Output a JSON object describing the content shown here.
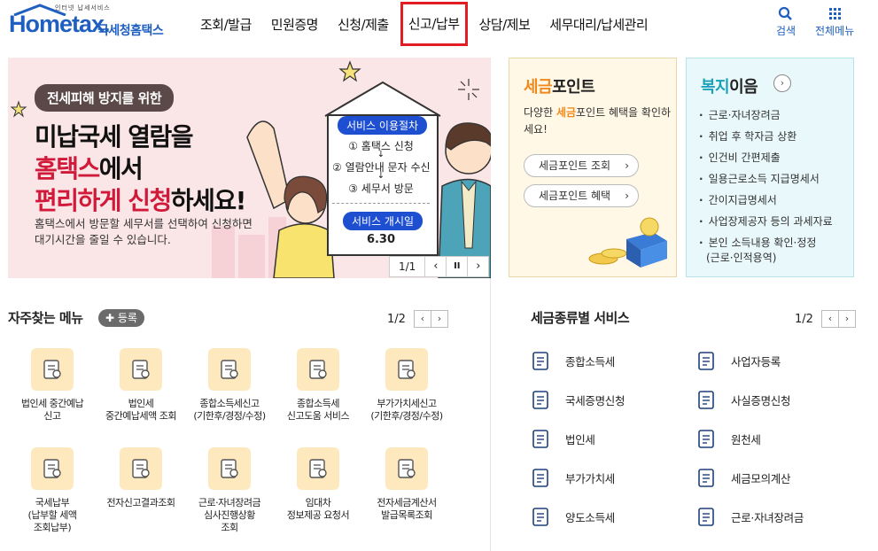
{
  "header": {
    "logo_small": "인터넷 납세서비스",
    "logo_main": "Hometax.",
    "logo_org": "국세청홈택스",
    "nav": [
      "조회/발급",
      "민원증명",
      "신청/제출",
      "신고/납부",
      "상담/제보",
      "세무대리/납세관리"
    ],
    "search_label": "검색",
    "menu_label": "전체메뉴"
  },
  "banner": {
    "pill": "전세피해 방지를 위한",
    "line1": "미납국세 열람을",
    "line2_hl": "홈택스",
    "line2_rest": "에서",
    "line3_hl": "편리하게 신청",
    "line3_rest": "하세요!",
    "desc1": "홈택스에서 방문할 세무서를 선택하여 신청하면",
    "desc2": "대기시간을 줄일 수 있습니다.",
    "proc_title": "서비스 이용절차",
    "step1": "① 홈택스 신청",
    "step2": "② 열람안내 문자 수신",
    "step3": "③ 세무서 방문",
    "arrow": "↓",
    "start_title": "서비스 개시일",
    "start_date": "6.30",
    "page": "1/1",
    "prev": "‹",
    "pause": "II",
    "next": "›"
  },
  "tax_point": {
    "title_em": "세금",
    "title_rest": "포인트",
    "desc_a": "다양한 ",
    "desc_em": "세금",
    "desc_b": "포인트 혜택을 확인하세요!",
    "btn1": "세금포인트 조회",
    "btn2": "세금포인트 혜택",
    "arrow": "›"
  },
  "welfare": {
    "title_em": "복지",
    "title_rest": "이음",
    "circle": "›",
    "items": [
      "근로·자녀장려금",
      "취업 후 학자금 상환",
      "인건비 간편제출",
      "일용근로소득 지급명세서",
      "간이지급명세서",
      "사업장제공자 등의 과세자료",
      "본인 소득내용 확인·정정",
      "(근로·인적용역)"
    ]
  },
  "favorites": {
    "title": "자주찾는 메뉴",
    "add": "등록",
    "page": "1/2",
    "prev": "‹",
    "next": "›",
    "items": [
      {
        "l1": "법인세 중간예납",
        "l2": "신고",
        "l3": ""
      },
      {
        "l1": "법인세",
        "l2": "중간예납세액 조회",
        "l3": ""
      },
      {
        "l1": "종합소득세신고",
        "l2": "(기한후/경정/수정)",
        "l3": ""
      },
      {
        "l1": "종합소득세",
        "l2": "신고도움 서비스",
        "l3": ""
      },
      {
        "l1": "부가가치세신고",
        "l2": "(기한후/경정/수정)",
        "l3": ""
      },
      {
        "l1": "국세납부",
        "l2": "(납부할 세액",
        "l3": "조회납부)"
      },
      {
        "l1": "전자신고결과조회",
        "l2": "",
        "l3": ""
      },
      {
        "l1": "근로·자녀장려금",
        "l2": "심사진행상황",
        "l3": "조회"
      },
      {
        "l1": "임대차",
        "l2": "정보제공 요청서",
        "l3": ""
      },
      {
        "l1": "전자세금계산서",
        "l2": "발급목록조회",
        "l3": ""
      }
    ]
  },
  "tax_services": {
    "title": "세금종류별 서비스",
    "page": "1/2",
    "prev": "‹",
    "next": "›",
    "items": [
      "종합소득세",
      "사업자등록",
      "국세증명신청",
      "사실증명신청",
      "법인세",
      "원천세",
      "부가가치세",
      "세금모의계산",
      "양도소득세",
      "근로·자녀장려금"
    ]
  },
  "colors": {
    "brand": "#1f5fbf",
    "active_outline": "#e31b23",
    "banner_bg": "#fbe6e7",
    "banner_accent": "#d11a3a",
    "tile_bg": "#fde9bd",
    "point_orange": "#f08a1c",
    "welfare_teal": "#1aa0b8"
  }
}
